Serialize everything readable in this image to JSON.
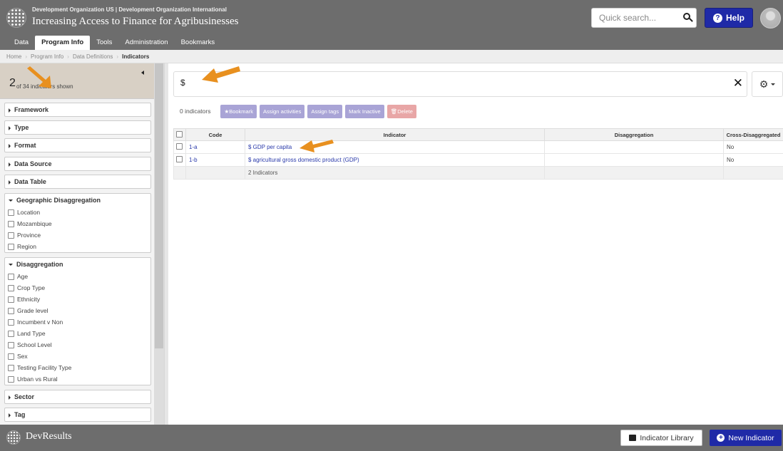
{
  "header": {
    "org": "Development Organization US | Development Organization International",
    "program": "Increasing Access to Finance for Agribusinesses",
    "search_placeholder": "Quick search...",
    "help_label": "Help"
  },
  "nav": {
    "items": [
      "Data",
      "Program Info",
      "Tools",
      "Administration",
      "Bookmarks"
    ],
    "active": "Program Info"
  },
  "breadcrumb": {
    "items": [
      "Home",
      "Program Info",
      "Data Definitions"
    ],
    "current": "Indicators"
  },
  "sidebar": {
    "shown_count": "2",
    "shown_text": "of 34 indicators shown",
    "facets": {
      "framework": "Framework",
      "type": "Type",
      "format": "Format",
      "data_source": "Data Source",
      "data_table": "Data Table",
      "geo": {
        "label": "Geographic Disaggregation",
        "options": [
          "Location",
          "Mozambique",
          "Province",
          "Region"
        ]
      },
      "disagg": {
        "label": "Disaggregation",
        "options": [
          "Age",
          "Crop Type",
          "Ethnicity",
          "Grade level",
          "Incumbent v Non",
          "Land Type",
          "School Level",
          "Sex",
          "Testing Facility Type",
          "Urban vs Rural"
        ]
      },
      "sector": "Sector",
      "tag": "Tag"
    }
  },
  "main": {
    "search_value": "$",
    "selected_count": "0 indicators",
    "actions": {
      "bookmark": "★Bookmark",
      "assign_activities": "Assign activities",
      "assign_tags": "Assign tags",
      "mark_inactive": "Mark Inactive",
      "delete": "🗑Delete"
    },
    "table": {
      "headers": [
        "Code",
        "Indicator",
        "Disaggregation",
        "Cross-Disaggregated"
      ],
      "rows": [
        {
          "code": "1-a",
          "indicator": "$ GDP per capita",
          "disaggregation": "",
          "cross": "No"
        },
        {
          "code": "1-b",
          "indicator": "$ agricultural gross domestic product (GDP)",
          "disaggregation": "",
          "cross": "No"
        }
      ],
      "footer": "2 Indicators"
    }
  },
  "footer": {
    "brand": "DevResults",
    "library_label": "Indicator Library",
    "new_label": "New Indicator"
  },
  "colors": {
    "chrome": "#6d6d6d",
    "primary": "#1f2aa7",
    "action": "#a9a4d6",
    "danger": "#e8a6a6",
    "arrow": "#e8901f"
  }
}
